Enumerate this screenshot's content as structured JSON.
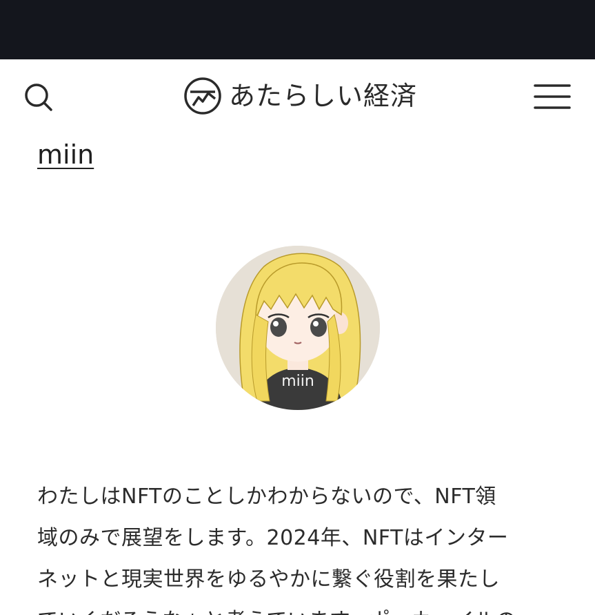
{
  "header": {
    "logo_text": "あたらしい経済",
    "search_icon": "search-icon",
    "menu_icon": "hamburger-menu-icon",
    "logo_icon": "logo-mark-icon"
  },
  "author": {
    "name": "miin",
    "avatar_shirt_text": "miin"
  },
  "article": {
    "lines": [
      "わたしはNFTのことしかわからないので、NFT領",
      "域のみで展望をします。2024年、NFTはインター",
      "ネットと現実世界をゆるやかに繋ぐ役割を果たし",
      "ていくだろうなぁと考えています。ポーカーイルの"
    ]
  },
  "colors": {
    "status_bar": "#14161d",
    "text": "#2b2b2b",
    "hair": "#f3dc6a",
    "avatar_bg": "#e6e0d6"
  }
}
